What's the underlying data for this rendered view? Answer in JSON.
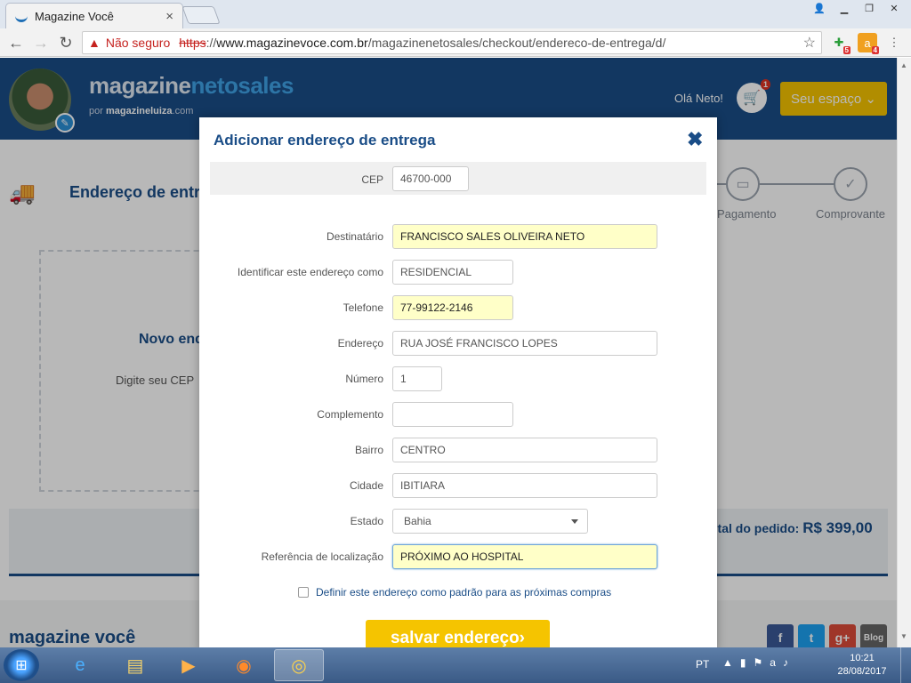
{
  "browser": {
    "tab_title": "Magazine Você",
    "tab_close": "×",
    "url_warning": "Não seguro",
    "url_scheme": "https",
    "url_sep": "://",
    "url_host": "www.magazinevoce.com.br",
    "url_path": "/magazinenetosales/checkout/endereco-de-entrega/d/",
    "ext1_badge": "5",
    "ext2_badge": "4"
  },
  "header": {
    "logo_main": "magazine",
    "logo_accent": "netosales",
    "logo_sub_prefix": "por",
    "logo_sub_brand": "magazineluiza",
    "logo_sub_suffix": ".com",
    "greeting": "Olá Neto!",
    "cart_count": "1",
    "seu_espaco": "Seu espaço ⌄"
  },
  "page": {
    "section_title": "Endereço de entr",
    "steps": [
      "Pagamento",
      "Comprovante"
    ],
    "novo_label": "Novo end",
    "digite_label": "Digite seu CEP",
    "total_label": "otal do pedido:",
    "total_value": "R$ 399,00",
    "footer_logo": "magazine você",
    "social": [
      "f",
      "t",
      "g+",
      "Blog"
    ]
  },
  "modal": {
    "title": "Adicionar endereço de entrega",
    "close": "✖",
    "fields": {
      "cep": {
        "label": "CEP",
        "value": "46700-000"
      },
      "destinatario": {
        "label": "Destinatário",
        "value": "FRANCISCO SALES OLIVEIRA NETO"
      },
      "identificar": {
        "label": "Identificar este endereço como",
        "value": "RESIDENCIAL"
      },
      "telefone": {
        "label": "Telefone",
        "value": "77-99122-2146"
      },
      "endereco": {
        "label": "Endereço",
        "value": "RUA JOSÉ FRANCISCO LOPES"
      },
      "numero": {
        "label": "Número",
        "value": "1"
      },
      "complemento": {
        "label": "Complemento",
        "value": ""
      },
      "bairro": {
        "label": "Bairro",
        "value": "CENTRO"
      },
      "cidade": {
        "label": "Cidade",
        "value": "IBITIARA"
      },
      "estado": {
        "label": "Estado",
        "value": "Bahia"
      },
      "referencia": {
        "label": "Referência de localização",
        "value": "PRÓXIMO AO HOSPITAL"
      }
    },
    "default_checkbox": "Definir este endereço como padrão para as próximas compras",
    "save_button": "salvar endereço›"
  },
  "taskbar": {
    "language": "PT",
    "time": "10:21",
    "date": "28/08/2017"
  }
}
